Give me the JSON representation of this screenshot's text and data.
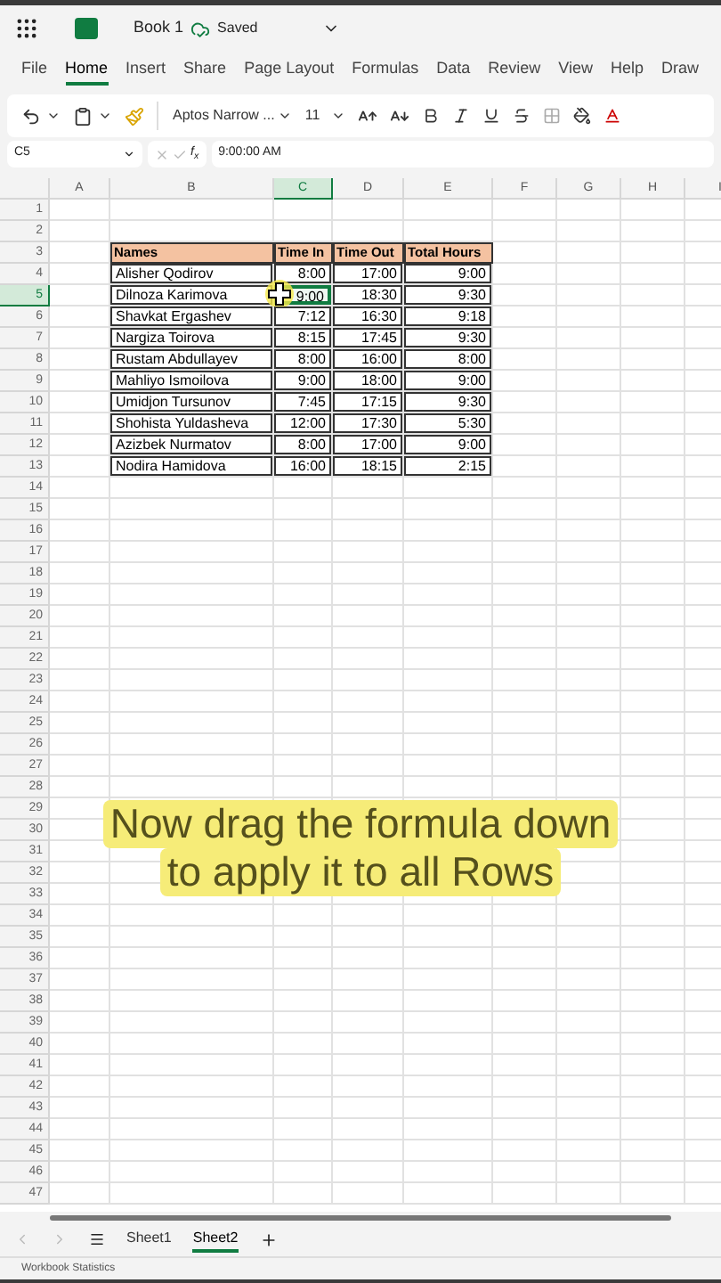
{
  "title_bar": {
    "file_name": "Book 1",
    "save_status": "Saved"
  },
  "menu_tabs": [
    {
      "label": "File",
      "selected": false
    },
    {
      "label": "Home",
      "selected": true
    },
    {
      "label": "Insert",
      "selected": false
    },
    {
      "label": "Share",
      "selected": false
    },
    {
      "label": "Page Layout",
      "selected": false
    },
    {
      "label": "Formulas",
      "selected": false
    },
    {
      "label": "Data",
      "selected": false
    },
    {
      "label": "Review",
      "selected": false
    },
    {
      "label": "View",
      "selected": false
    },
    {
      "label": "Help",
      "selected": false
    },
    {
      "label": "Draw",
      "selected": false
    }
  ],
  "toolbar": {
    "font_name": "Aptos Narrow ...",
    "font_size": "11"
  },
  "formula_bar": {
    "cell_ref": "C5",
    "function_label": "f$_{x}$",
    "formula": "9:00:00 AM"
  },
  "columns": [
    {
      "label": "A",
      "selected": false
    },
    {
      "label": "B",
      "selected": false
    },
    {
      "label": "C",
      "selected": true
    },
    {
      "label": "D",
      "selected": false
    },
    {
      "label": "E",
      "selected": false
    },
    {
      "label": "F",
      "selected": false
    },
    {
      "label": "G",
      "selected": false
    },
    {
      "label": "H",
      "selected": false
    },
    {
      "label": "I",
      "selected": false
    }
  ],
  "row_numbers": [
    {
      "label": "1",
      "selected": false
    },
    {
      "label": "2",
      "selected": false
    },
    {
      "label": "3",
      "selected": false
    },
    {
      "label": "4",
      "selected": false
    },
    {
      "label": "5",
      "selected": true
    },
    {
      "label": "6",
      "selected": false
    },
    {
      "label": "7",
      "selected": false
    },
    {
      "label": "8",
      "selected": false
    },
    {
      "label": "9",
      "selected": false
    },
    {
      "label": "10",
      "selected": false
    },
    {
      "label": "11",
      "selected": false
    },
    {
      "label": "12",
      "selected": false
    },
    {
      "label": "13",
      "selected": false
    },
    {
      "label": "14",
      "selected": false
    },
    {
      "label": "15",
      "selected": false
    },
    {
      "label": "16",
      "selected": false
    },
    {
      "label": "17",
      "selected": false
    },
    {
      "label": "18",
      "selected": false
    },
    {
      "label": "19",
      "selected": false
    },
    {
      "label": "20",
      "selected": false
    },
    {
      "label": "21",
      "selected": false
    },
    {
      "label": "22",
      "selected": false
    },
    {
      "label": "23",
      "selected": false
    },
    {
      "label": "24",
      "selected": false
    },
    {
      "label": "25",
      "selected": false
    },
    {
      "label": "26",
      "selected": false
    },
    {
      "label": "27",
      "selected": false
    },
    {
      "label": "28",
      "selected": false
    },
    {
      "label": "29",
      "selected": false
    },
    {
      "label": "30",
      "selected": false
    },
    {
      "label": "31",
      "selected": false
    },
    {
      "label": "32",
      "selected": false
    },
    {
      "label": "33",
      "selected": false
    },
    {
      "label": "34",
      "selected": false
    },
    {
      "label": "35",
      "selected": false
    },
    {
      "label": "36",
      "selected": false
    },
    {
      "label": "37",
      "selected": false
    },
    {
      "label": "38",
      "selected": false
    },
    {
      "label": "39",
      "selected": false
    },
    {
      "label": "40",
      "selected": false
    },
    {
      "label": "41",
      "selected": false
    },
    {
      "label": "42",
      "selected": false
    },
    {
      "label": "43",
      "selected": false
    },
    {
      "label": "44",
      "selected": false
    },
    {
      "label": "45",
      "selected": false
    },
    {
      "label": "46",
      "selected": false
    },
    {
      "label": "47",
      "selected": false
    }
  ],
  "table": {
    "header": [
      "Names",
      "Time In",
      "Time Out",
      "Total Hours"
    ],
    "rows": [
      {
        "name": "Alisher Qodirov",
        "time_in": "8:00",
        "time_out": "17:00",
        "total": "9:00",
        "selected": false
      },
      {
        "name": "Dilnoza Karimova",
        "time_in": "9:00",
        "time_out": "18:30",
        "total": "9:30",
        "selected": true
      },
      {
        "name": "Shavkat Ergashev",
        "time_in": "7:12",
        "time_out": "16:30",
        "total": "9:18",
        "selected": false
      },
      {
        "name": "Nargiza Toirova",
        "time_in": "8:15",
        "time_out": "17:45",
        "total": "9:30",
        "selected": false
      },
      {
        "name": "Rustam Abdullayev",
        "time_in": "8:00",
        "time_out": "16:00",
        "total": "8:00",
        "selected": false
      },
      {
        "name": "Mahliyo Ismoilova",
        "time_in": "9:00",
        "time_out": "18:00",
        "total": "9:00",
        "selected": false
      },
      {
        "name": "Umidjon Tursunov",
        "time_in": "7:45",
        "time_out": "17:15",
        "total": "9:30",
        "selected": false
      },
      {
        "name": "Shohista Yuldasheva",
        "time_in": "12:00",
        "time_out": "17:30",
        "total": "5:30",
        "selected": false
      },
      {
        "name": "Azizbek Nurmatov",
        "time_in": "8:00",
        "time_out": "17:00",
        "total": "9:00",
        "selected": false
      },
      {
        "name": "Nodira Hamidova",
        "time_in": "16:00",
        "time_out": "18:15",
        "total": "2:15",
        "selected": false
      }
    ]
  },
  "caption": {
    "lines": [
      "Now drag the formula down",
      "to apply it to all Rows"
    ]
  },
  "sheet_tabs": [
    {
      "label": "Sheet1",
      "selected": false
    },
    {
      "label": "Sheet2",
      "selected": true
    }
  ],
  "status_bar": {
    "text": "Workbook Statistics"
  }
}
